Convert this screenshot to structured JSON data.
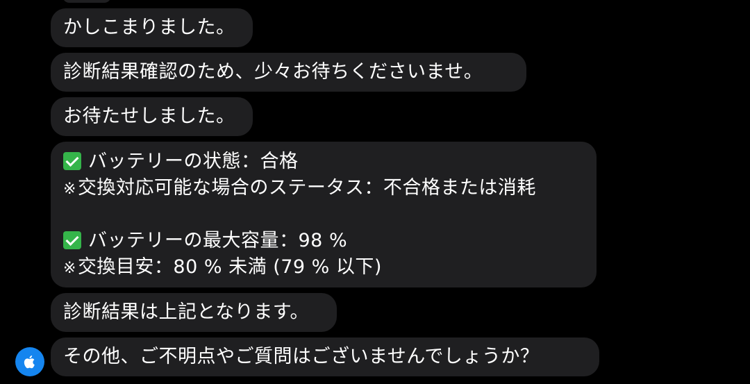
{
  "chat": {
    "messages": [
      {
        "lines": [
          "かしこまりました。"
        ]
      },
      {
        "lines": [
          "診断結果確認のため、少々お待ちくださいませ。"
        ]
      },
      {
        "lines": [
          "お待たせしました。"
        ]
      },
      {
        "battery_status_label": "バッテリーの状態：合格",
        "battery_status_note": "交換対応可能な場合のステータス：不合格または消耗",
        "battery_capacity_label": "バッテリーの最大容量：98 %",
        "battery_capacity_note": "交換目安：80 % 未満 (79 % 以下)",
        "note_mark": "※"
      },
      {
        "lines": [
          "診断結果は上記となります。"
        ]
      },
      {
        "lines": [
          "その他、ご不明点やご質問はございませんでしょうか？"
        ]
      }
    ]
  },
  "avatar": {
    "icon": "apple-logo-icon",
    "color": "#1585ef"
  },
  "colors": {
    "background": "#000000",
    "bubble": "#1f1f21",
    "check": "#35b54a"
  }
}
